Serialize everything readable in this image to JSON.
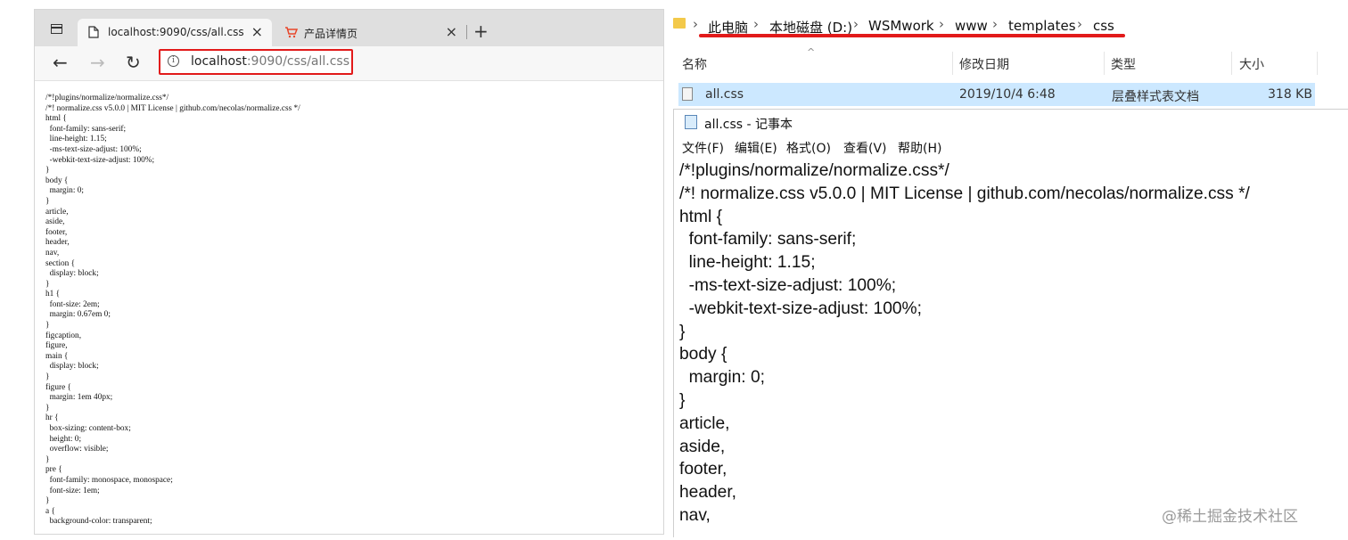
{
  "browser": {
    "tabs": [
      {
        "label": "localhost:9090/css/all.css",
        "close": "×",
        "icon": "page-icon"
      },
      {
        "label": "产品详情页",
        "close": "×",
        "icon": "cart-icon"
      }
    ],
    "new_tab": "+",
    "nav": {
      "back": "←",
      "forward": "→",
      "reload": "↻"
    },
    "address": {
      "host": "localhost",
      "rest": ":9090/css/all.css",
      "info": "i"
    },
    "page_text": "/*!plugins/normalize/normalize.css*/\n/*! normalize.css v5.0.0 | MIT License | github.com/necolas/normalize.css */\nhtml {\n  font-family: sans-serif;\n  line-height: 1.15;\n  -ms-text-size-adjust: 100%;\n  -webkit-text-size-adjust: 100%;\n}\nbody {\n  margin: 0;\n}\narticle,\naside,\nfooter,\nheader,\nnav,\nsection {\n  display: block;\n}\nh1 {\n  font-size: 2em;\n  margin: 0.67em 0;\n}\nfigcaption,\nfigure,\nmain {\n  display: block;\n}\nfigure {\n  margin: 1em 40px;\n}\nhr {\n  box-sizing: content-box;\n  height: 0;\n  overflow: visible;\n}\npre {\n  font-family: monospace, monospace;\n  font-size: 1em;\n}\na {\n  background-color: transparent;"
  },
  "explorer": {
    "breadcrumb": [
      "此电脑",
      "本地磁盘 (D:)",
      "WSMwork",
      "www",
      "templates",
      "css"
    ],
    "columns": [
      "名称",
      "修改日期",
      "类型",
      "大小"
    ],
    "file": {
      "name": "all.css",
      "modified": "2019/10/4 6:48",
      "type": "层叠样式表文档",
      "size": "318 KB"
    }
  },
  "notepad": {
    "title": "all.css - 记事本",
    "menu": [
      "文件(F)",
      "编辑(E)",
      "格式(O)",
      "查看(V)",
      "帮助(H)"
    ],
    "text": "/*!plugins/normalize/normalize.css*/\n/*! normalize.css v5.0.0 | MIT License | github.com/necolas/normalize.css */\nhtml {\n  font-family: sans-serif;\n  line-height: 1.15;\n  -ms-text-size-adjust: 100%;\n  -webkit-text-size-adjust: 100%;\n}\nbody {\n  margin: 0;\n}\narticle,\naside,\nfooter,\nheader,\nnav,"
  },
  "watermark": "@稀土掘金技术社区",
  "colors": {
    "highlight": "#e21a1a",
    "selection": "#cce8ff",
    "folder": "#f3c94a"
  }
}
